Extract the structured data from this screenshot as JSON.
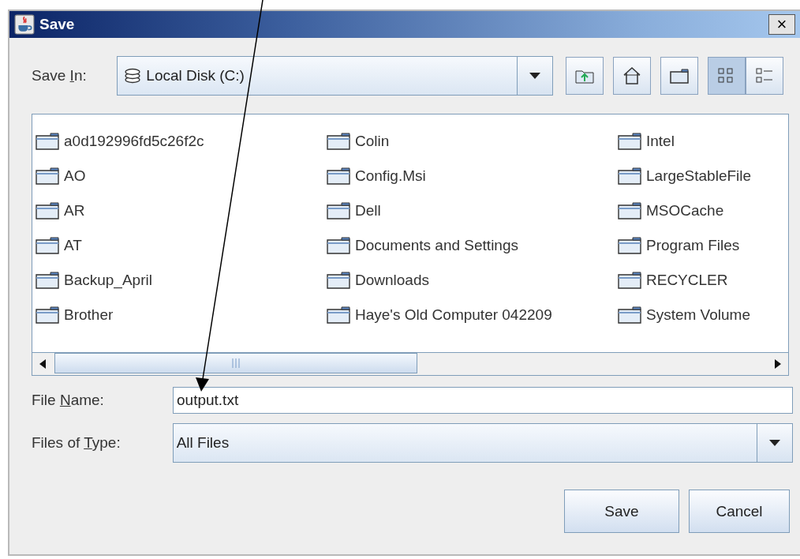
{
  "window": {
    "title": "Save",
    "close": "×"
  },
  "save_in": {
    "label": {
      "before": "Save ",
      "key": "I",
      "after": "n:"
    },
    "value": "Local Disk (C:)"
  },
  "toolbar": [
    {
      "kind": "up",
      "selected": false
    },
    {
      "kind": "home",
      "selected": false
    },
    {
      "kind": "new-folder",
      "selected": false
    },
    {
      "kind": "list",
      "selected": true
    },
    {
      "kind": "details",
      "selected": false
    }
  ],
  "files": [
    {
      "name": "a0d192996fd5c26f2c"
    },
    {
      "name": "AO"
    },
    {
      "name": "AR"
    },
    {
      "name": "AT"
    },
    {
      "name": "Backup_April"
    },
    {
      "name": "Brother"
    },
    {
      "name": "Colin"
    },
    {
      "name": "Config.Msi"
    },
    {
      "name": "Dell"
    },
    {
      "name": "Documents and Settings"
    },
    {
      "name": "Downloads"
    },
    {
      "name": "Haye's Old Computer 042209"
    },
    {
      "name": "Intel"
    },
    {
      "name": "LargeStableFile"
    },
    {
      "name": "MSOCache"
    },
    {
      "name": "Program Files"
    },
    {
      "name": "RECYCLER"
    },
    {
      "name": "System Volume"
    }
  ],
  "file_name": {
    "label": {
      "before": "File ",
      "key": "N",
      "after": "ame:"
    },
    "value": "output.txt"
  },
  "file_type": {
    "label": {
      "before": "Files of ",
      "key": "T",
      "after": "ype:"
    },
    "value": "All Files"
  },
  "buttons": [
    "Save",
    "Cancel"
  ]
}
